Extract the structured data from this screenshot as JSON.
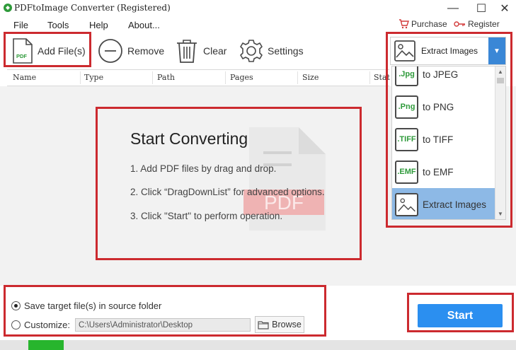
{
  "window": {
    "title": "PDFtoImage Converter (Registered)",
    "controls": {
      "minimize": "—",
      "maximize": "☐",
      "close": "✕"
    }
  },
  "menu": {
    "items": [
      "File",
      "Tools",
      "Help",
      "About..."
    ]
  },
  "header_links": {
    "purchase": "Purchase",
    "register": "Register"
  },
  "toolbar": {
    "add_files": "Add File(s)",
    "remove": "Remove",
    "clear": "Clear",
    "settings": "Settings",
    "pdf_badge": "PDF"
  },
  "mode_select": {
    "value": "Extract Images",
    "arrow": "▼"
  },
  "file_table": {
    "columns": [
      "Name",
      "Type",
      "Path",
      "Pages",
      "Size",
      "Stat"
    ]
  },
  "guide": {
    "title": "Start Converting",
    "steps": [
      "1. Add PDF files by drag and drop.",
      "2. Click “DragDownList” for advanced options.",
      "3. Click \"Start\" to perform operation."
    ],
    "watermark": "PDF"
  },
  "dropdown": {
    "items": [
      {
        "badge": ".Jpg",
        "label": "to JPEG",
        "selected": false
      },
      {
        "badge": ".Png",
        "label": "to PNG",
        "selected": false
      },
      {
        "badge": ".TIFF",
        "label": "to TIFF",
        "selected": false
      },
      {
        "badge": ".EMF",
        "label": "to EMF",
        "selected": false
      },
      {
        "badge": "",
        "label": "Extract Images",
        "selected": true
      }
    ],
    "scroll_up": "▲",
    "scroll_down": "▼"
  },
  "output": {
    "source_label": "Save target file(s) in source folder",
    "customize_label": "Customize:",
    "path_value": "C:\\Users\\Administrator\\Desktop",
    "browse": "Browse",
    "selected_option": "source"
  },
  "start_button": "Start",
  "progress": {
    "fraction": 0.068
  },
  "colors": {
    "highlight_red": "#cc2a2f",
    "accent_blue": "#2b8ff0",
    "selected_item": "#8db9e6",
    "progress_green": "#27b52d",
    "badge_green": "#2e9a3a"
  }
}
